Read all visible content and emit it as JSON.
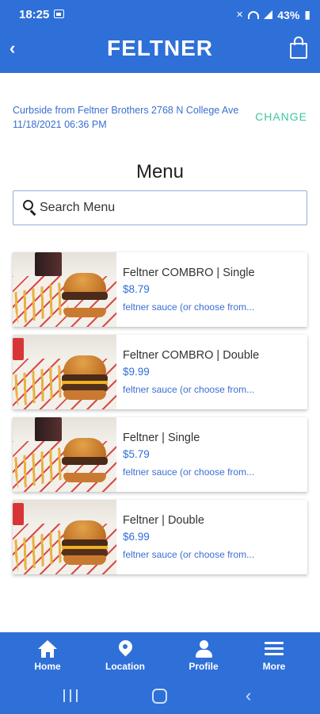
{
  "status_bar": {
    "time": "18:25",
    "battery": "43%",
    "icons": [
      "photo-icon",
      "mute-icon",
      "wifi-icon",
      "signal-icon",
      "battery-icon"
    ]
  },
  "header": {
    "title": "FELTNER",
    "back_icon": "chevron-left-icon",
    "cart_icon": "shopping-bag-icon"
  },
  "order": {
    "info": "Curbside from Feltner Brothers 2768 N College Ave 11/18/2021 06:36 PM",
    "change_label": "CHANGE"
  },
  "menu": {
    "title": "Menu",
    "search_placeholder": "Search Menu",
    "items": [
      {
        "name": "Feltner COMBRO | Single",
        "price": "$8.79",
        "description": "feltner sauce (or choose from..."
      },
      {
        "name": "Feltner COMBRO | Double",
        "price": "$9.99",
        "description": "feltner sauce (or choose from..."
      },
      {
        "name": "Feltner | Single",
        "price": "$5.79",
        "description": "feltner sauce (or choose from..."
      },
      {
        "name": "Feltner | Double",
        "price": "$6.99",
        "description": "feltner sauce (or choose from..."
      }
    ]
  },
  "bottom_nav": [
    {
      "label": "Home",
      "icon": "home-icon"
    },
    {
      "label": "Location",
      "icon": "location-pin-icon"
    },
    {
      "label": "Profile",
      "icon": "user-icon"
    },
    {
      "label": "More",
      "icon": "menu-icon"
    }
  ],
  "colors": {
    "primary": "#2f6fd8",
    "accent": "#3cc7a0",
    "link_text": "#3a6fd0"
  }
}
